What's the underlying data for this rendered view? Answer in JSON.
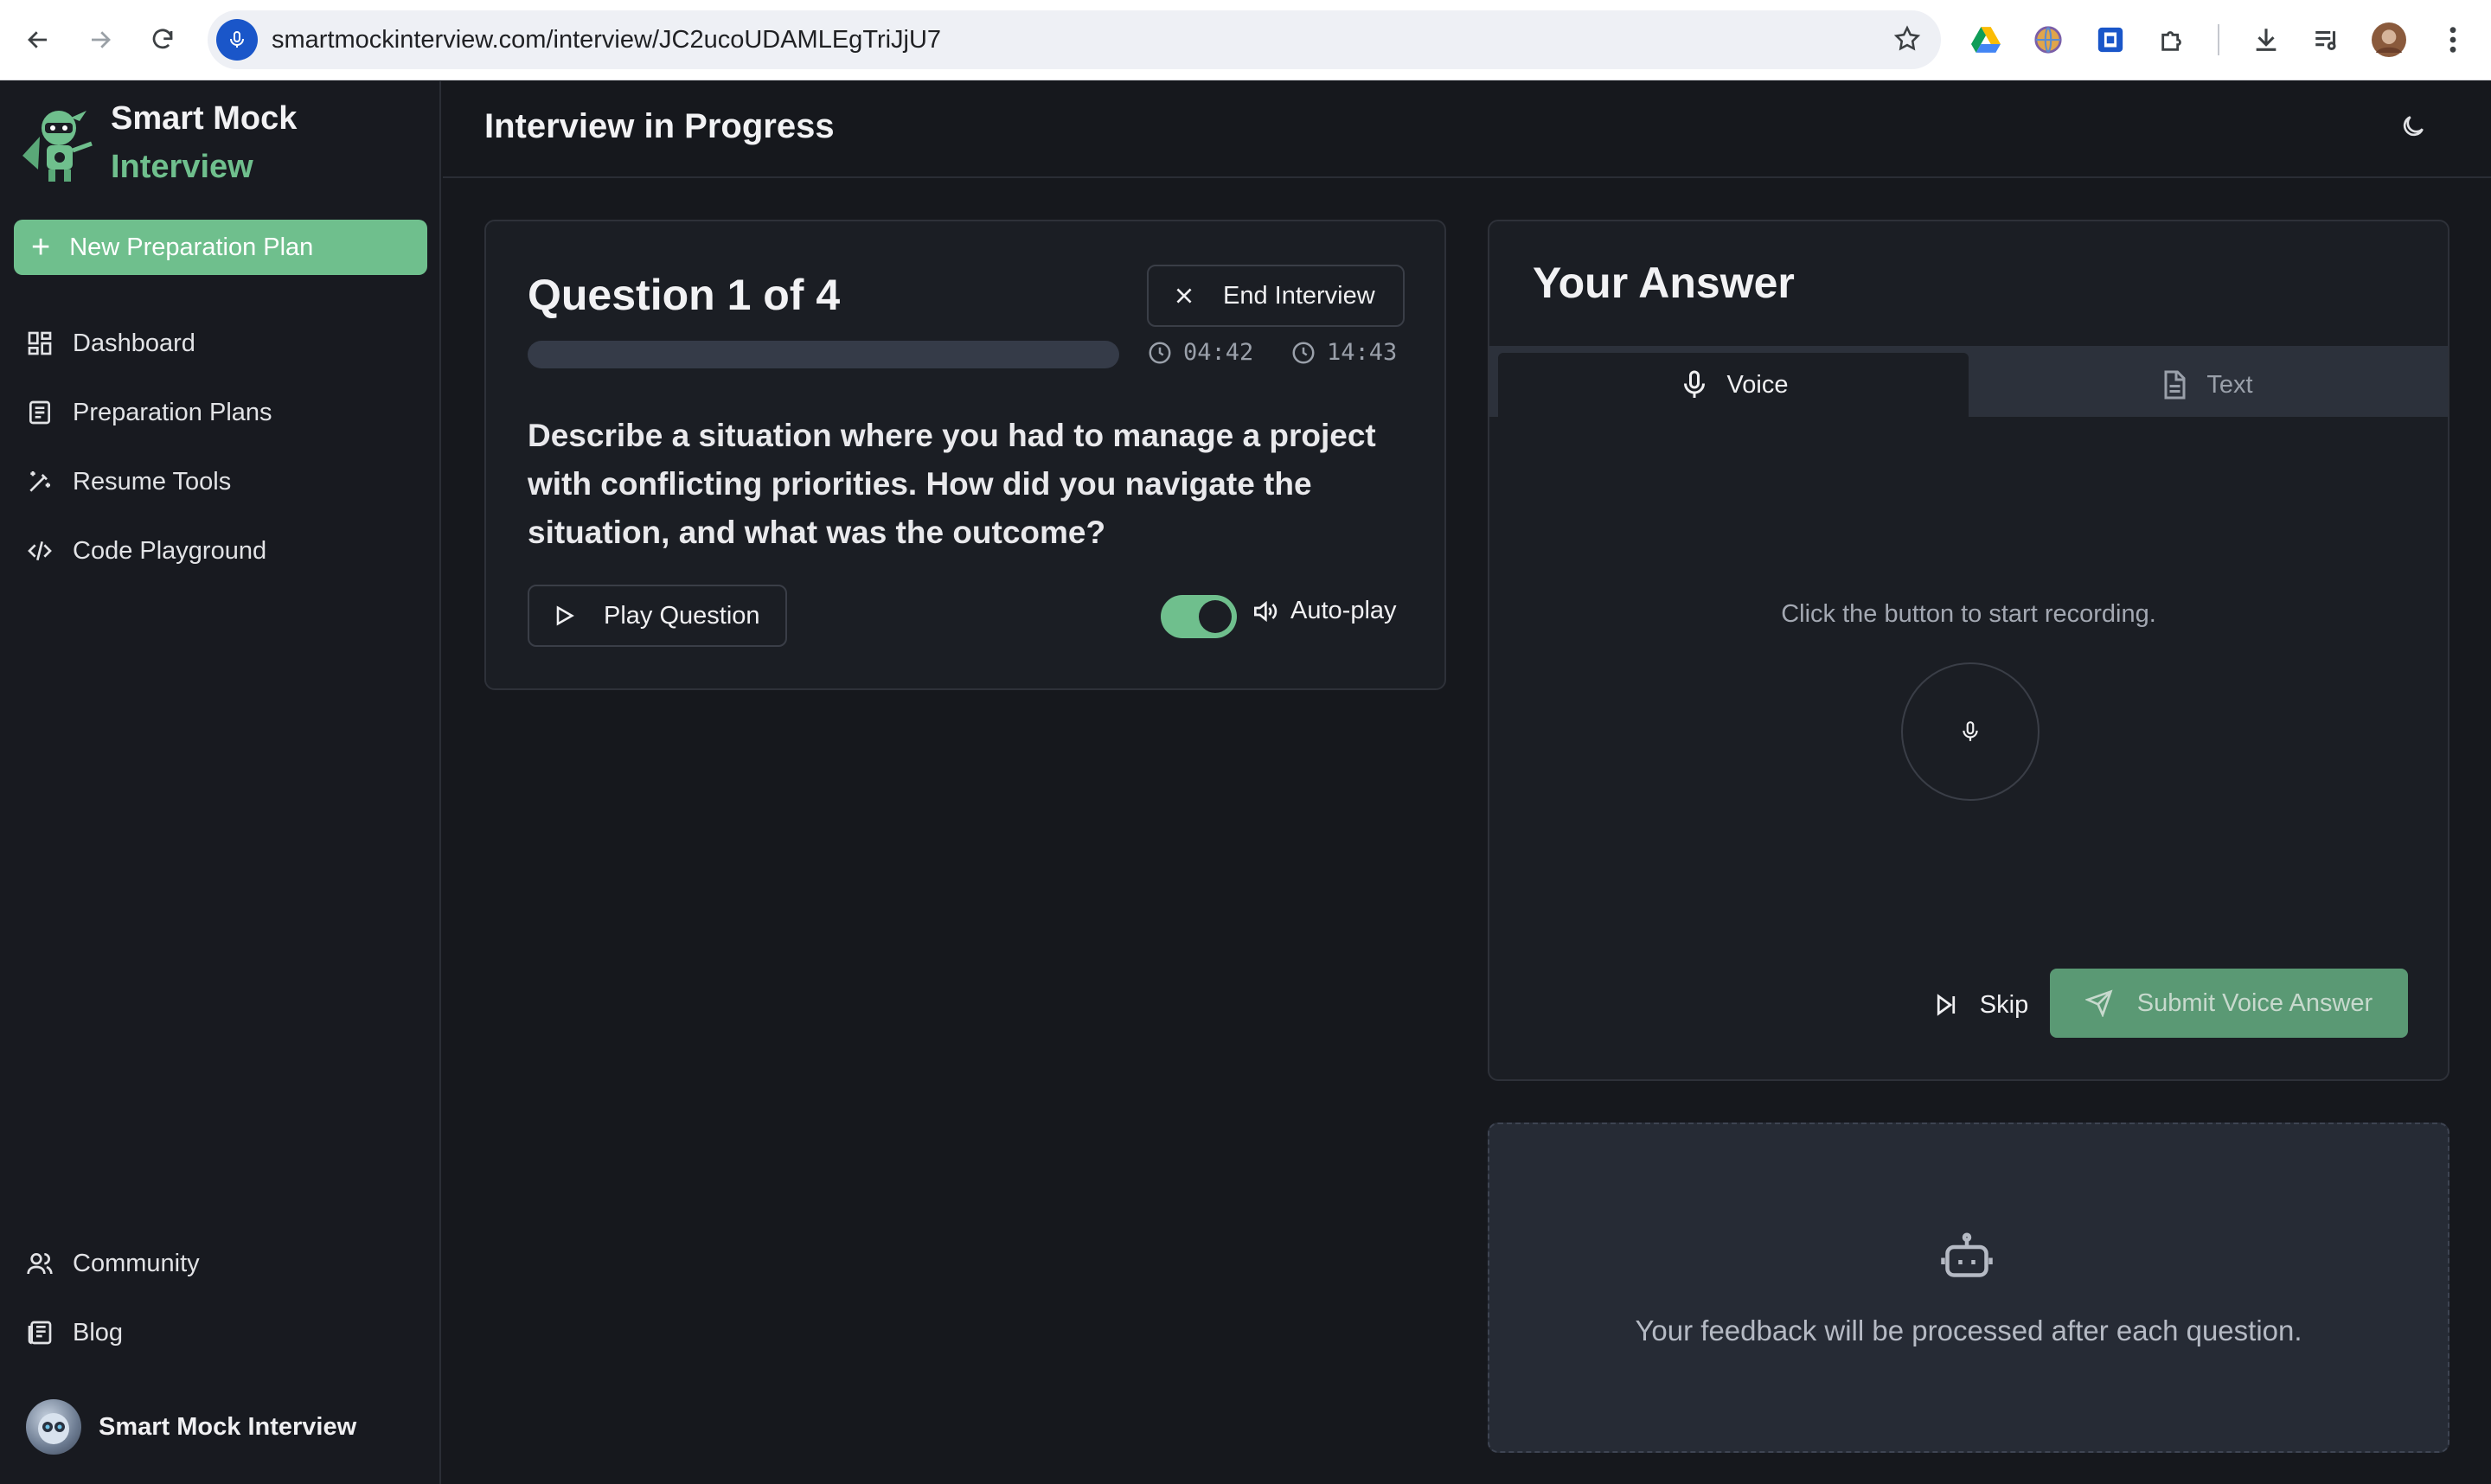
{
  "browser": {
    "url": "smartmockinterview.com/interview/JC2ucoUDAMLEgTriJjU7",
    "icons": [
      "back-arrow-icon",
      "forward-arrow-icon",
      "reload-icon",
      "mic-icon",
      "star-icon",
      "google-drive-icon",
      "globe-extension-icon",
      "badge-extension-icon",
      "puzzle-extension-icon",
      "download-icon",
      "media-control-icon",
      "profile-avatar",
      "kebab-menu-icon"
    ]
  },
  "sidebar": {
    "brand_line1": "Smart Mock",
    "brand_line2": "Interview",
    "new_plan_label": "New Preparation Plan",
    "items": [
      {
        "label": "Dashboard",
        "icon": "dashboard-icon"
      },
      {
        "label": "Preparation Plans",
        "icon": "notebook-icon"
      },
      {
        "label": "Resume Tools",
        "icon": "magic-wand-icon"
      },
      {
        "label": "Code Playground",
        "icon": "code-icon"
      }
    ],
    "bottom_items": [
      {
        "label": "Community",
        "icon": "users-icon"
      },
      {
        "label": "Blog",
        "icon": "newspaper-icon"
      }
    ],
    "user_name": "Smart Mock Interview"
  },
  "header": {
    "title": "Interview in Progress",
    "theme_icon": "moon-icon"
  },
  "question_card": {
    "title": "Question 1 of 4",
    "end_label": "End Interview",
    "progress_percent": 0,
    "timer_question": "04:42",
    "timer_total": "14:43",
    "question_text": "Describe a situation where you had to manage a project with conflicting priorities. How did you navigate the situation, and what was the outcome?",
    "play_label": "Play Question",
    "autoplay_label": "Auto-play",
    "autoplay_on": true
  },
  "answer_card": {
    "title": "Your Answer",
    "tabs": [
      {
        "label": "Voice",
        "icon": "mic-icon",
        "active": true
      },
      {
        "label": "Text",
        "icon": "document-icon",
        "active": false
      }
    ],
    "hint": "Click the button to start recording.",
    "skip_label": "Skip",
    "submit_label": "Submit Voice Answer"
  },
  "feedback_card": {
    "text": "Your feedback will be processed after each question.",
    "icon": "bot-icon"
  },
  "colors": {
    "accent": "#6fbf8d",
    "background": "#16181d",
    "card": "#1b1e24"
  }
}
